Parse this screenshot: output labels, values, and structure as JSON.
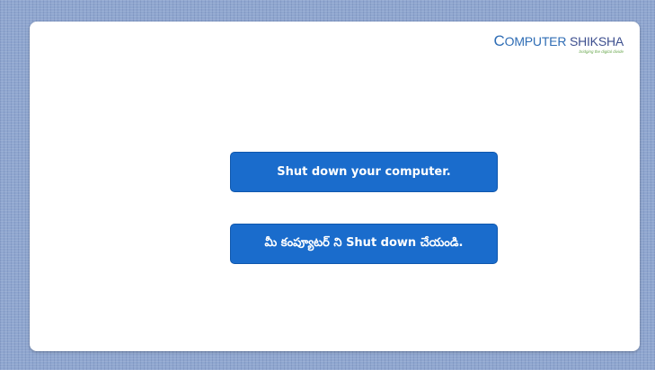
{
  "logo": {
    "first_letter": "C",
    "word1_rest": "OMPUTER",
    "word2": "SHIKSHA",
    "tagline": "bridging the digital divide"
  },
  "message": {
    "english": "Shut down your computer.",
    "telugu": "మీ కంప్యూటర్ ని Shut down చేయండి."
  },
  "colors": {
    "background": "#8fa6cf",
    "slide": "#ffffff",
    "button": "#1a6ccc",
    "logo_blue": "#2f6db5",
    "logo_green": "#6aa84f"
  }
}
